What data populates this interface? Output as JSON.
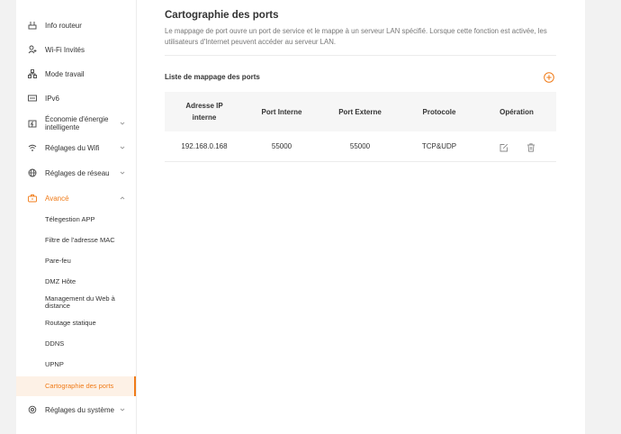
{
  "sidebar": {
    "items": [
      {
        "label": "Info routeur",
        "icon": "router-icon"
      },
      {
        "label": "Wi-Fi Invités",
        "icon": "guest-user-icon"
      },
      {
        "label": "Mode travail",
        "icon": "network-mode-icon"
      },
      {
        "label": "IPv6",
        "icon": "ipv6-icon"
      },
      {
        "label": "Économie d'énergie intelligente",
        "icon": "energy-saving-icon"
      },
      {
        "label": "Réglages du Wifi",
        "icon": "wifi-icon"
      },
      {
        "label": "Réglages de réseau",
        "icon": "globe-icon"
      },
      {
        "label": "Avancé",
        "icon": "toolbox-icon"
      },
      {
        "label": "Réglages du système",
        "icon": "system-settings-icon"
      }
    ],
    "advanced_sub": [
      "Télegestion APP",
      "Filtre de l'adresse MAC",
      "Pare-feu",
      "DMZ Hôte",
      "Management du Web à distance",
      "Routage statique",
      "DDNS",
      "UPNP",
      "Cartographie des ports"
    ]
  },
  "main": {
    "title": "Cartographie des ports",
    "description": "Le mappage de port ouvre un port de service et le mappe à un serveur LAN spécifié. Lorsque cette fonction est activée, les utilisateurs d'Internet peuvent accéder au serveur LAN.",
    "list_title": "Liste de mappage des ports",
    "table": {
      "headers": [
        "Adresse IP interne",
        "Port Interne",
        "Port Externe",
        "Protocole",
        "Opération"
      ],
      "rows": [
        {
          "ip": "192.168.0.168",
          "internal_port": "55000",
          "external_port": "55000",
          "protocol": "TCP&UDP"
        }
      ]
    }
  },
  "colors": {
    "accent": "#f07b18",
    "background": "#f2f2f2",
    "header_bg": "#f6f6f6"
  }
}
